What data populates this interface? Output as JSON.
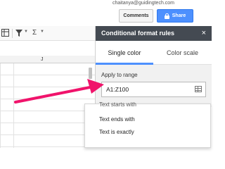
{
  "header": {
    "account_email": "chaitanya@guidingtech.com",
    "comments_label": "Comments",
    "share_label": "Share",
    "accent_color": "#4d90fe"
  },
  "toolbar": {
    "icons": [
      "table-icon",
      "filter-icon",
      "sigma-icon"
    ],
    "sigma_glyph": "Σ"
  },
  "grid": {
    "column_label": "J"
  },
  "panel": {
    "title": "Conditional format rules",
    "close_glyph": "×",
    "tabs": [
      {
        "label": "Single color",
        "active": true
      },
      {
        "label": "Color scale",
        "active": false
      }
    ],
    "apply_to_range_label": "Apply to range",
    "range_value": "A1:Z100",
    "header_color": "#444a52"
  },
  "dropdown": {
    "clipped_item": "Text starts with",
    "items": [
      "Text ends with",
      "Text is exactly"
    ]
  },
  "annotation": {
    "arrow_color": "#f0136b"
  }
}
